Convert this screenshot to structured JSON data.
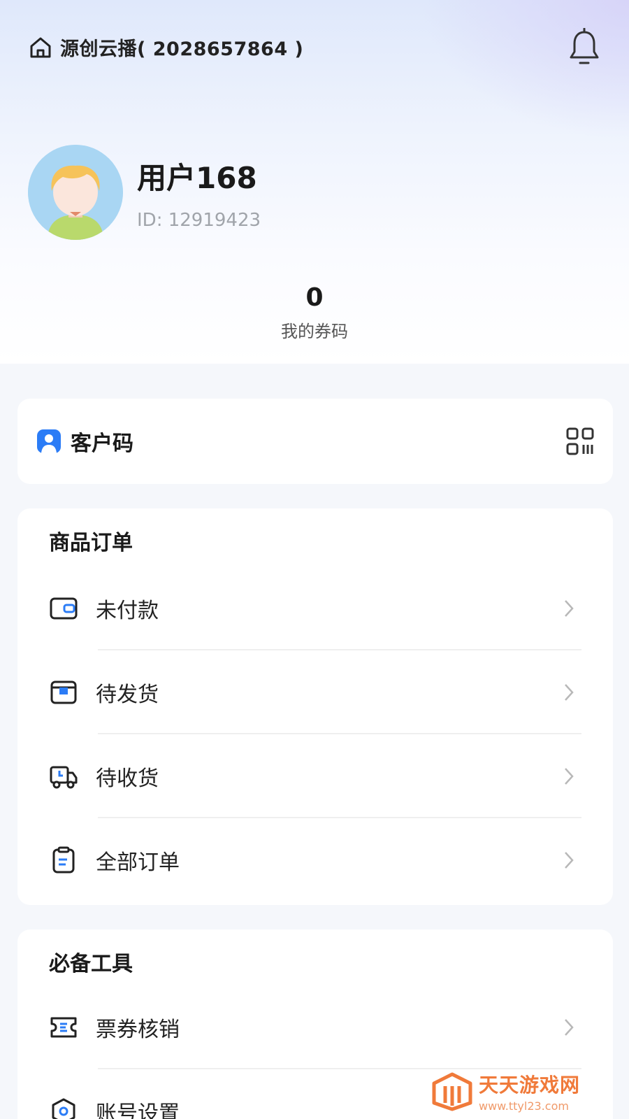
{
  "header": {
    "shop_name": "源创云播( 2028657864 )"
  },
  "profile": {
    "username": "用户168",
    "user_id": "ID: 12919423"
  },
  "coupon": {
    "count": "0",
    "label": "我的券码"
  },
  "customer_code": {
    "label": "客户码"
  },
  "orders": {
    "title": "商品订单",
    "items": [
      {
        "label": "未付款",
        "icon": "wallet-icon"
      },
      {
        "label": "待发货",
        "icon": "package-box-icon"
      },
      {
        "label": "待收货",
        "icon": "delivery-truck-icon"
      },
      {
        "label": "全部订单",
        "icon": "clipboard-icon"
      }
    ]
  },
  "tools": {
    "title": "必备工具",
    "items": [
      {
        "label": "票券核销",
        "icon": "ticket-icon"
      },
      {
        "label": "账号设置",
        "icon": "settings-icon"
      }
    ]
  },
  "watermark": {
    "title": "天天游戏网",
    "url": "www.ttyl23.com"
  },
  "colors": {
    "accent": "#2b7cf6",
    "watermark": "#f07a3a"
  }
}
